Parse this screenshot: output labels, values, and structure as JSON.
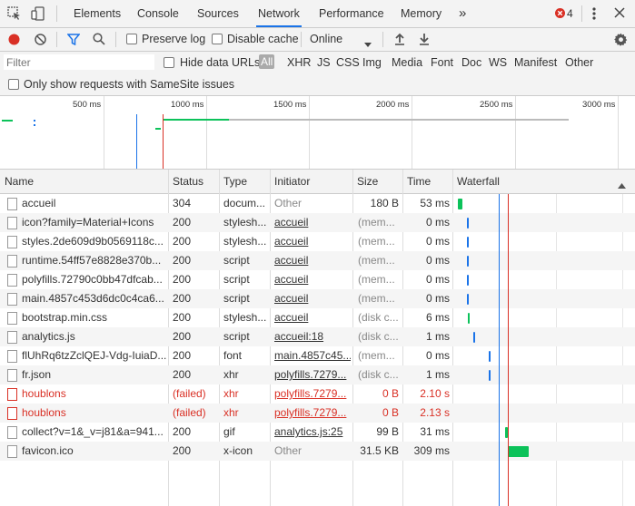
{
  "tabs": [
    {
      "label": "Elements",
      "active": false
    },
    {
      "label": "Console",
      "active": false
    },
    {
      "label": "Sources",
      "active": false
    },
    {
      "label": "Network",
      "active": true
    },
    {
      "label": "Performance",
      "active": false
    },
    {
      "label": "Memory",
      "active": false
    }
  ],
  "more_tabs": "»",
  "error_count": "4",
  "toolbar": {
    "preserve_log": "Preserve log",
    "disable_cache": "Disable cache",
    "throttle": "Online"
  },
  "filter": {
    "placeholder": "Filter",
    "hide_data_urls": "Hide data URLs",
    "types": [
      "All",
      "XHR",
      "JS",
      "CSS",
      "Img",
      "Media",
      "Font",
      "Doc",
      "WS",
      "Manifest",
      "Other"
    ],
    "samesite": "Only show requests with SameSite issues"
  },
  "overview": {
    "ticks": [
      "500 ms",
      "1000 ms",
      "1500 ms",
      "2000 ms",
      "2500 ms",
      "3000 ms"
    ]
  },
  "table": {
    "headers": {
      "name": "Name",
      "status": "Status",
      "type": "Type",
      "initiator": "Initiator",
      "size": "Size",
      "time": "Time",
      "waterfall": "Waterfall"
    },
    "rows": [
      {
        "name": "accueil",
        "status": "304",
        "type": "docum...",
        "initiator": "Other",
        "initiator_link": false,
        "size": "180 B",
        "size_muted": false,
        "time": "53 ms",
        "failed": false
      },
      {
        "name": "icon?family=Material+Icons",
        "status": "200",
        "type": "stylesh...",
        "initiator": "accueil",
        "initiator_link": true,
        "size": "(mem...",
        "size_muted": true,
        "time": "0 ms",
        "failed": false
      },
      {
        "name": "styles.2de609d9b0569118c...",
        "status": "200",
        "type": "stylesh...",
        "initiator": "accueil",
        "initiator_link": true,
        "size": "(mem...",
        "size_muted": true,
        "time": "0 ms",
        "failed": false
      },
      {
        "name": "runtime.54ff57e8828e370b...",
        "status": "200",
        "type": "script",
        "initiator": "accueil",
        "initiator_link": true,
        "size": "(mem...",
        "size_muted": true,
        "time": "0 ms",
        "failed": false
      },
      {
        "name": "polyfills.72790c0bb47dfcab...",
        "status": "200",
        "type": "script",
        "initiator": "accueil",
        "initiator_link": true,
        "size": "(mem...",
        "size_muted": true,
        "time": "0 ms",
        "failed": false
      },
      {
        "name": "main.4857c453d6dc0c4ca6...",
        "status": "200",
        "type": "script",
        "initiator": "accueil",
        "initiator_link": true,
        "size": "(mem...",
        "size_muted": true,
        "time": "0 ms",
        "failed": false
      },
      {
        "name": "bootstrap.min.css",
        "status": "200",
        "type": "stylesh...",
        "initiator": "accueil",
        "initiator_link": true,
        "size": "(disk c...",
        "size_muted": true,
        "time": "6 ms",
        "failed": false
      },
      {
        "name": "analytics.js",
        "status": "200",
        "type": "script",
        "initiator": "accueil:18",
        "initiator_link": true,
        "size": "(disk c...",
        "size_muted": true,
        "time": "1 ms",
        "failed": false
      },
      {
        "name": "flUhRq6tzZclQEJ-Vdg-IuiaD...",
        "status": "200",
        "type": "font",
        "initiator": "main.4857c45...",
        "initiator_link": true,
        "size": "(mem...",
        "size_muted": true,
        "time": "0 ms",
        "failed": false
      },
      {
        "name": "fr.json",
        "status": "200",
        "type": "xhr",
        "initiator": "polyfills.7279...",
        "initiator_link": true,
        "size": "(disk c...",
        "size_muted": true,
        "time": "1 ms",
        "failed": false
      },
      {
        "name": "houblons",
        "status": "(failed)",
        "type": "xhr",
        "initiator": "polyfills.7279...",
        "initiator_link": true,
        "size": "0 B",
        "size_muted": false,
        "time": "2.10 s",
        "failed": true
      },
      {
        "name": "houblons",
        "status": "(failed)",
        "type": "xhr",
        "initiator": "polyfills.7279...",
        "initiator_link": true,
        "size": "0 B",
        "size_muted": false,
        "time": "2.13 s",
        "failed": true
      },
      {
        "name": "collect?v=1&_v=j81&a=941...",
        "status": "200",
        "type": "gif",
        "initiator": "analytics.js:25",
        "initiator_link": true,
        "size": "99 B",
        "size_muted": false,
        "time": "31 ms",
        "failed": false
      },
      {
        "name": "favicon.ico",
        "status": "200",
        "type": "x-icon",
        "initiator": "Other",
        "initiator_link": false,
        "size": "31.5 KB",
        "size_muted": false,
        "time": "309 ms",
        "failed": false
      }
    ]
  },
  "colors": {
    "accent": "#1a73e8",
    "error": "#d93025",
    "record": "#d93025",
    "bar_green": "#0cc25a",
    "bar_blue": "#1a73e8"
  }
}
